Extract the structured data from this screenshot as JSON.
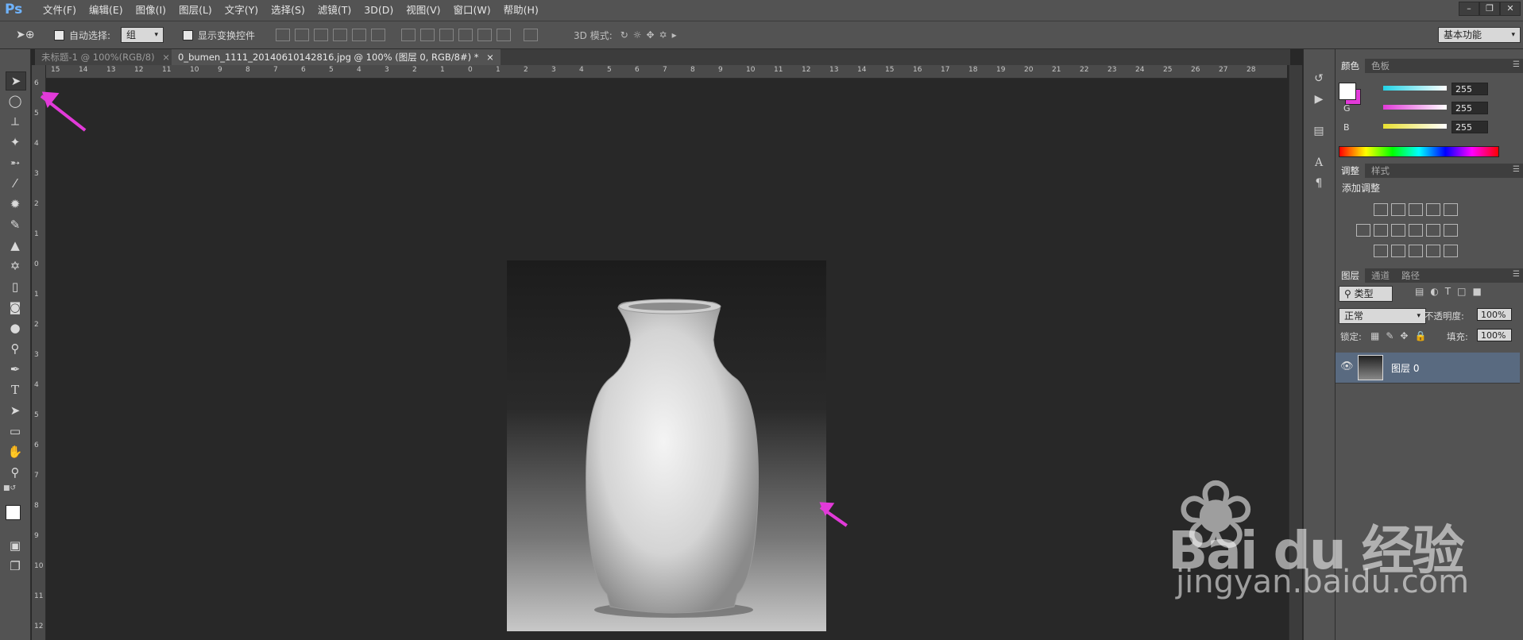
{
  "app": {
    "logo": "Ps"
  },
  "menu": [
    "文件(F)",
    "编辑(E)",
    "图像(I)",
    "图层(L)",
    "文字(Y)",
    "选择(S)",
    "滤镜(T)",
    "3D(D)",
    "视图(V)",
    "窗口(W)",
    "帮助(H)"
  ],
  "options": {
    "auto_select_label": "自动选择:",
    "auto_select_value": "组",
    "show_transform_label": "显示变换控件",
    "mode_3d_label": "3D 模式:",
    "workspace": "基本功能"
  },
  "tabs": [
    {
      "label": "未标题-1 @ 100%(RGB/8)"
    },
    {
      "label": "0_bumen_1111_20140610142816.jpg @ 100% (图层 0, RGB/8#) *"
    }
  ],
  "ruler": {
    "top": [
      "15",
      "14",
      "13",
      "12",
      "11",
      "10",
      "9",
      "8",
      "7",
      "6",
      "5",
      "4",
      "3",
      "2",
      "1",
      "0",
      "1",
      "2",
      "3",
      "4",
      "5",
      "6",
      "7",
      "8",
      "9",
      "10",
      "11",
      "12",
      "13",
      "14",
      "15",
      "16",
      "17",
      "18",
      "19",
      "20",
      "21",
      "22",
      "23",
      "24",
      "25",
      "26",
      "27",
      "28"
    ],
    "left": [
      "6",
      "5",
      "4",
      "3",
      "2",
      "1",
      "0",
      "1",
      "2",
      "3",
      "4",
      "5",
      "6",
      "7",
      "8",
      "9",
      "10",
      "11",
      "12"
    ]
  },
  "color_panel": {
    "tabs": [
      "颜色",
      "色板"
    ],
    "channels": [
      {
        "name": "R",
        "value": "255",
        "color": "#22d3e6"
      },
      {
        "name": "G",
        "value": "255",
        "color": "#e23ad9"
      },
      {
        "name": "B",
        "value": "255",
        "color": "#e8e030"
      }
    ]
  },
  "adjust_panel": {
    "tabs": [
      "调整",
      "样式"
    ],
    "title": "添加调整"
  },
  "layers_panel": {
    "tabs": [
      "图层",
      "通道",
      "路径"
    ],
    "filter_label": "类型",
    "blend_mode": "正常",
    "opacity_label": "不透明度:",
    "opacity_value": "100%",
    "lock_label": "锁定:",
    "fill_label": "填充:",
    "fill_value": "100%",
    "layers": [
      {
        "name": "图层 0"
      }
    ]
  },
  "watermark": {
    "brand": "Bai du 经验",
    "url": "jingyan.baidu.com"
  },
  "colors": {
    "accent": "#e23ad9",
    "menubar": "#535353",
    "canvas": "#282828",
    "selected_layer": "#596a80"
  }
}
